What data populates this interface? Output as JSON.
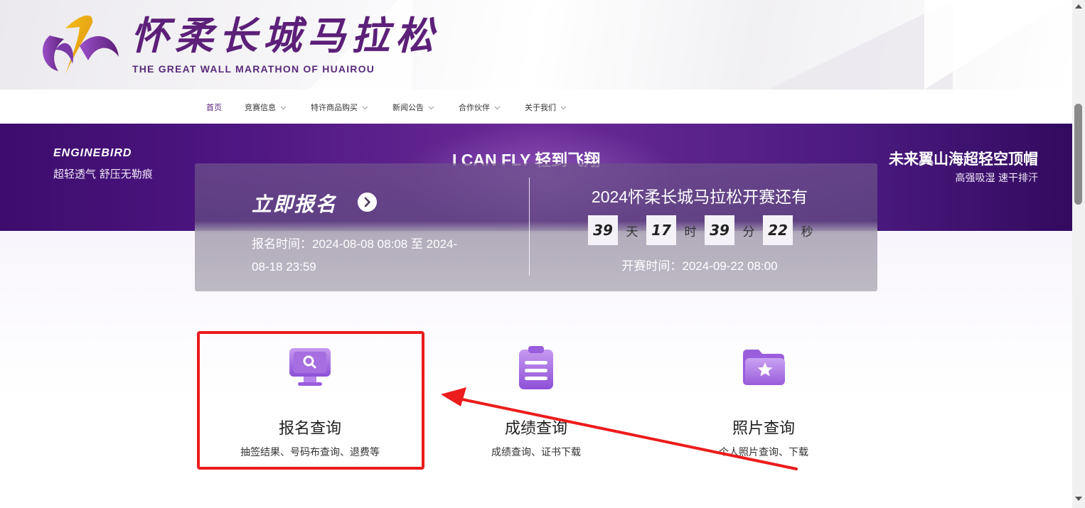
{
  "header": {
    "logo_cn": "怀柔长城马拉松",
    "logo_en": "THE GREAT WALL MARATHON OF HUAIROU"
  },
  "nav": {
    "items": [
      {
        "label": "首页",
        "active": true,
        "dropdown": false
      },
      {
        "label": "竞赛信息",
        "active": false,
        "dropdown": true
      },
      {
        "label": "特许商品购买",
        "active": false,
        "dropdown": true
      },
      {
        "label": "新闻公告",
        "active": false,
        "dropdown": true
      },
      {
        "label": "合作伙伴",
        "active": false,
        "dropdown": true
      },
      {
        "label": "关于我们",
        "active": false,
        "dropdown": true
      }
    ]
  },
  "banner": {
    "brand": "ENGINEBIRD",
    "brand_sub": "超轻透气 舒压无勒痕",
    "center": "I CAN FLY 轻到飞翔",
    "right_title": "未来翼山海超轻空顶帽",
    "right_sub": "高强吸湿 速干排汗"
  },
  "registration": {
    "title": "立即报名",
    "time_label": "报名时间：2024-08-08 08:08 至 2024-08-18 23:59"
  },
  "countdown": {
    "title": "2024怀柔长城马拉松开赛还有",
    "days": "39",
    "days_unit": "天",
    "hours": "17",
    "hours_unit": "时",
    "minutes": "39",
    "minutes_unit": "分",
    "seconds": "22",
    "seconds_unit": "秒",
    "start_time": "开赛时间：2024-09-22 08:00"
  },
  "cards": [
    {
      "title": "报名查询",
      "sub": "抽签结果、号码布查询、退费等",
      "icon": "monitor-search-icon"
    },
    {
      "title": "成绩查询",
      "sub": "成绩查询、证书下载",
      "icon": "clipboard-list-icon"
    },
    {
      "title": "照片查询",
      "sub": "个人照片查询、下载",
      "icon": "folder-star-icon"
    }
  ],
  "colors": {
    "brand_purple": "#5c2079",
    "banner_purple": "#4c1580",
    "highlight_red": "#ec1c1c",
    "icon_purple": "#a66ee0"
  }
}
